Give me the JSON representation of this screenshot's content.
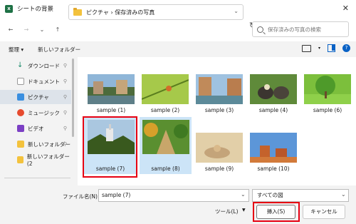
{
  "window": {
    "title": "シートの背景"
  },
  "address": {
    "path": "ピクチャ  ›  保存済みの写真"
  },
  "search": {
    "placeholder": "保存済みの写真の検索"
  },
  "toolbar": {
    "organize": "整理 ▾",
    "new_folder": "新しいフォルダー"
  },
  "sidebar": {
    "items": [
      {
        "label": "ダウンロード",
        "icon": "download-icon"
      },
      {
        "label": "ドキュメント",
        "icon": "document-icon"
      },
      {
        "label": "ピクチャ",
        "icon": "pictures-icon"
      },
      {
        "label": "ミュージック",
        "icon": "music-icon"
      },
      {
        "label": "ビデオ",
        "icon": "video-icon"
      },
      {
        "label": "新しいフォルダー",
        "icon": "folder-icon"
      },
      {
        "label": "新しいフォルダー (2",
        "icon": "folder-icon"
      }
    ]
  },
  "files": [
    {
      "name": "sample (1)"
    },
    {
      "name": "sample (2)"
    },
    {
      "name": "sample (3)"
    },
    {
      "name": "sample (4)"
    },
    {
      "name": "sample (6)"
    },
    {
      "name": "sample (7)"
    },
    {
      "name": "sample (8)"
    },
    {
      "name": "sample (9)"
    },
    {
      "name": "sample (10)"
    }
  ],
  "footer": {
    "filename_label": "ファイル名(N):",
    "filename_value": "sample (7)",
    "filter_value": "すべての図",
    "tools_label": "ツール(L)",
    "insert_label": "挿入(S)",
    "cancel_label": "キャンセル"
  },
  "colors": {
    "accent": "#0a62c5",
    "highlight": "#e60012",
    "selection": "#cce4f7"
  }
}
